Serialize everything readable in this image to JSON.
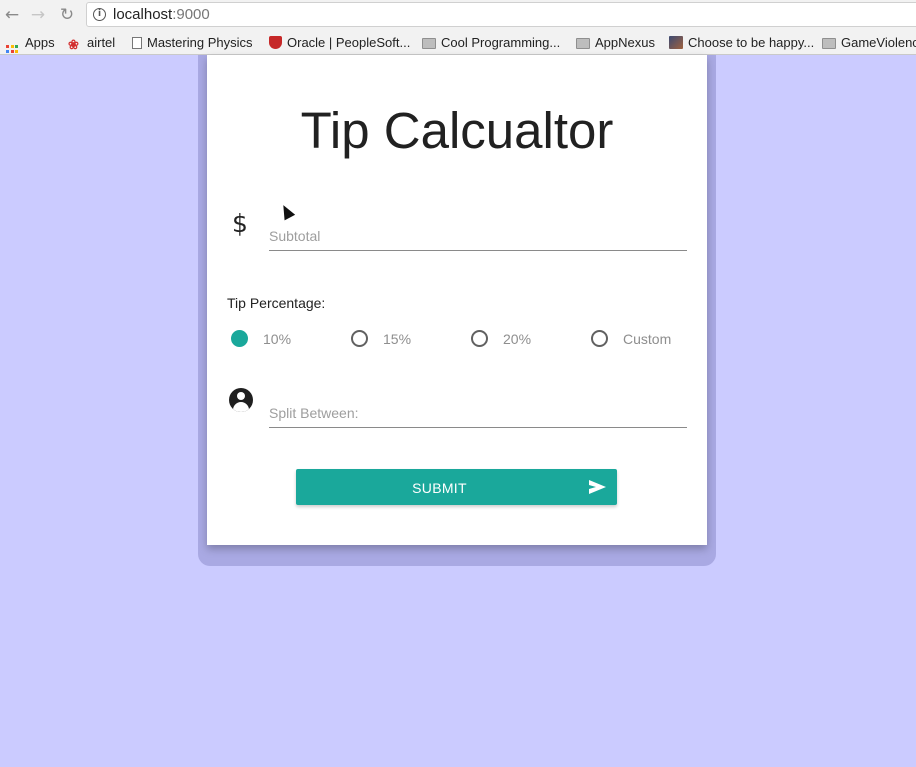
{
  "browser": {
    "url_host": "localhost",
    "url_port": ":9000",
    "bookmarks": [
      {
        "label": "Apps",
        "icon": "apps-grid-icon"
      },
      {
        "label": "airtel",
        "icon": "airtel-icon"
      },
      {
        "label": "Mastering Physics",
        "icon": "page-icon"
      },
      {
        "label": "Oracle | PeopleSoft...",
        "icon": "oracle-icon"
      },
      {
        "label": "Cool Programming...",
        "icon": "folder-icon"
      },
      {
        "label": "AppNexus",
        "icon": "folder-icon"
      },
      {
        "label": "Choose to be happy...",
        "icon": "photo-icon"
      },
      {
        "label": "GameViolence",
        "icon": "folder-icon"
      }
    ]
  },
  "form": {
    "title": "Tip Calcualtor",
    "subtotal_placeholder": "Subtotal",
    "tip_label": "Tip Percentage:",
    "tip_options": [
      {
        "label": "10%",
        "checked": true
      },
      {
        "label": "15%",
        "checked": false
      },
      {
        "label": "20%",
        "checked": false
      },
      {
        "label": "Custom",
        "checked": false
      }
    ],
    "split_placeholder": "Split Between:",
    "submit_label": "SUBMIT"
  },
  "colors": {
    "page_background": "#cbcbff",
    "accent": "#1aa89b"
  }
}
